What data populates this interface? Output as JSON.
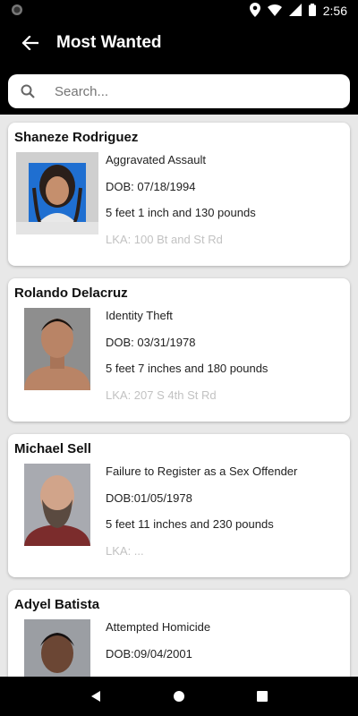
{
  "status_bar": {
    "time": "2:56"
  },
  "header": {
    "title": "Most Wanted"
  },
  "search": {
    "placeholder": "Search..."
  },
  "cards": [
    {
      "name": "Shaneze Rodriguez",
      "charge": "Aggravated Assault",
      "dob": "DOB: 07/18/1994",
      "size": "5 feet 1 inch and 130 pounds",
      "extra": "LKA: 100 Bt and St Rd",
      "photo": {
        "bg": "#1f6fd1",
        "skin": "#c58f6d",
        "hair": "#2a1f1a",
        "shirt": "#e8e8e8"
      }
    },
    {
      "name": "Rolando Delacruz",
      "charge": "Identity Theft",
      "dob": "DOB: 03/31/1978",
      "size": "5 feet 7 inches and 180 pounds",
      "extra": "LKA: 207 S 4th St Rd",
      "photo": {
        "bg": "#8e8e8e",
        "skin": "#b98466",
        "hair": "#1b1410",
        "shirt": "#b98466"
      }
    },
    {
      "name": "Michael Sell",
      "charge": "Failure to Register as a Sex Offender",
      "dob": "DOB:01/05/1978",
      "size": "5 feet 11 inches and 230 pounds",
      "extra": "LKA: ...",
      "photo": {
        "bg": "#a8aab0",
        "skin": "#d1a48a",
        "hair": "#5a4a40",
        "shirt": "#7b2c2c"
      }
    },
    {
      "name": "Adyel Batista",
      "charge": "Attempted Homicide",
      "dob": "DOB:09/04/2001",
      "size": "",
      "extra": "",
      "photo": {
        "bg": "#9b9ea3",
        "skin": "#6b4634",
        "hair": "#151010",
        "shirt": "#2b2b2b"
      }
    }
  ]
}
